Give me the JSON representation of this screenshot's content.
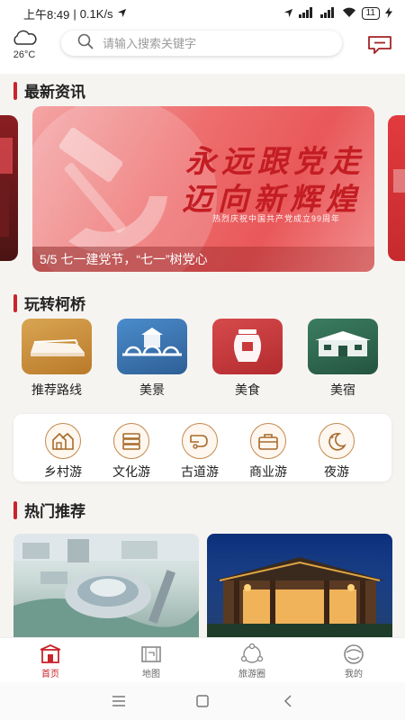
{
  "status_bar": {
    "time": "上午8:49",
    "speed": "0.1K/s",
    "battery": "11"
  },
  "header": {
    "weather_temp": "26°C",
    "weather_icon": "cloud-icon",
    "search_placeholder": "请输入搜索关键字",
    "message_icon": "chat-bubble-icon"
  },
  "news": {
    "section_title": "最新资讯",
    "banner": {
      "headline_line1": "永远跟党走",
      "headline_line2": "迈向新辉煌",
      "subline": "热烈庆祝中国共产党成立99周年",
      "caption": "5/5 七一建党节，“七一”树党心"
    }
  },
  "explore": {
    "section_title": "玩转柯桥",
    "categories": [
      {
        "label": "推荐路线",
        "icon": "route-icon",
        "color": "#c98e3a"
      },
      {
        "label": "美景",
        "icon": "bridge-icon",
        "color": "#3d7ab5"
      },
      {
        "label": "美食",
        "icon": "food-jar-icon",
        "color": "#c9383a"
      },
      {
        "label": "美宿",
        "icon": "hotel-icon",
        "color": "#2f6b52"
      }
    ],
    "themes": [
      {
        "label": "乡村游",
        "icon": "village-icon"
      },
      {
        "label": "文化游",
        "icon": "books-icon"
      },
      {
        "label": "古道游",
        "icon": "ancient-road-icon"
      },
      {
        "label": "商业游",
        "icon": "briefcase-icon"
      },
      {
        "label": "夜游",
        "icon": "moon-icon"
      }
    ]
  },
  "hot": {
    "section_title": "热门推荐"
  },
  "tabs": [
    {
      "label": "首页",
      "icon": "home-gate-icon",
      "active": true
    },
    {
      "label": "地图",
      "icon": "map-icon",
      "active": false
    },
    {
      "label": "旅游圈",
      "icon": "circle-network-icon",
      "active": false
    },
    {
      "label": "我的",
      "icon": "profile-icon",
      "active": false
    }
  ],
  "colors": {
    "accent": "#c8242b",
    "theme_outline": "#c48a4e"
  }
}
